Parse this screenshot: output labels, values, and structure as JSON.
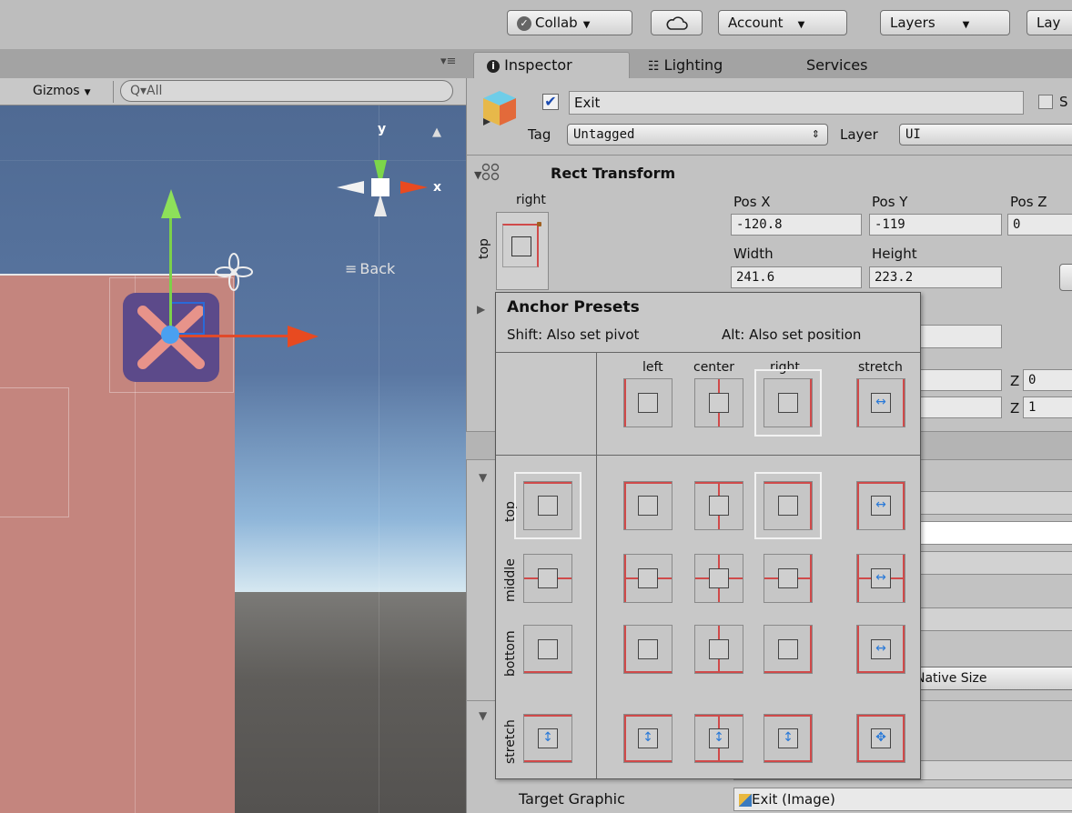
{
  "toolbar": {
    "collab": "Collab",
    "account": "Account",
    "layers": "Layers",
    "layout": "Lay",
    "cloud_icon": "cloud-icon"
  },
  "scene": {
    "gizmos": "Gizmos",
    "search_placeholder": "All",
    "axis_y": "y",
    "axis_x": "x",
    "back_label": "Back"
  },
  "tabs": [
    {
      "label": "Inspector",
      "icon": "info-icon"
    },
    {
      "label": "Lighting",
      "icon": "lighting-icon"
    },
    {
      "label": "Services"
    }
  ],
  "inspector": {
    "object_name": "Exit",
    "active": true,
    "static_label": "S",
    "tag_label": "Tag",
    "tag_value": "Untagged",
    "layer_label": "Layer",
    "layer_value": "UI",
    "rect_transform": "Rect Transform",
    "anchor_h": "right",
    "anchor_v": "top",
    "pos_x_label": "Pos X",
    "pos_y_label": "Pos Y",
    "pos_z_label": "Pos Z",
    "pos_x": "-120.8",
    "pos_y": "-119",
    "pos_z": "0",
    "width_label": "Width",
    "height_label": "Height",
    "width": "241.6",
    "height": "223.2",
    "z_label_1": "Z",
    "z_value_1": "0",
    "z_label_2": "Z",
    "z_value_2": "1",
    "native_size": "Native Size",
    "target_graphic_label": "Target Graphic",
    "target_graphic_value": "Exit (Image)"
  },
  "anchor_presets": {
    "title": "Anchor Presets",
    "hint_pivot": "Shift: Also set pivot",
    "hint_position": "Alt: Also set position",
    "columns": [
      "left",
      "center",
      "right",
      "stretch"
    ],
    "rows": [
      "top",
      "middle",
      "bottom",
      "stretch"
    ],
    "selected": {
      "row": "top",
      "column": "right"
    }
  }
}
